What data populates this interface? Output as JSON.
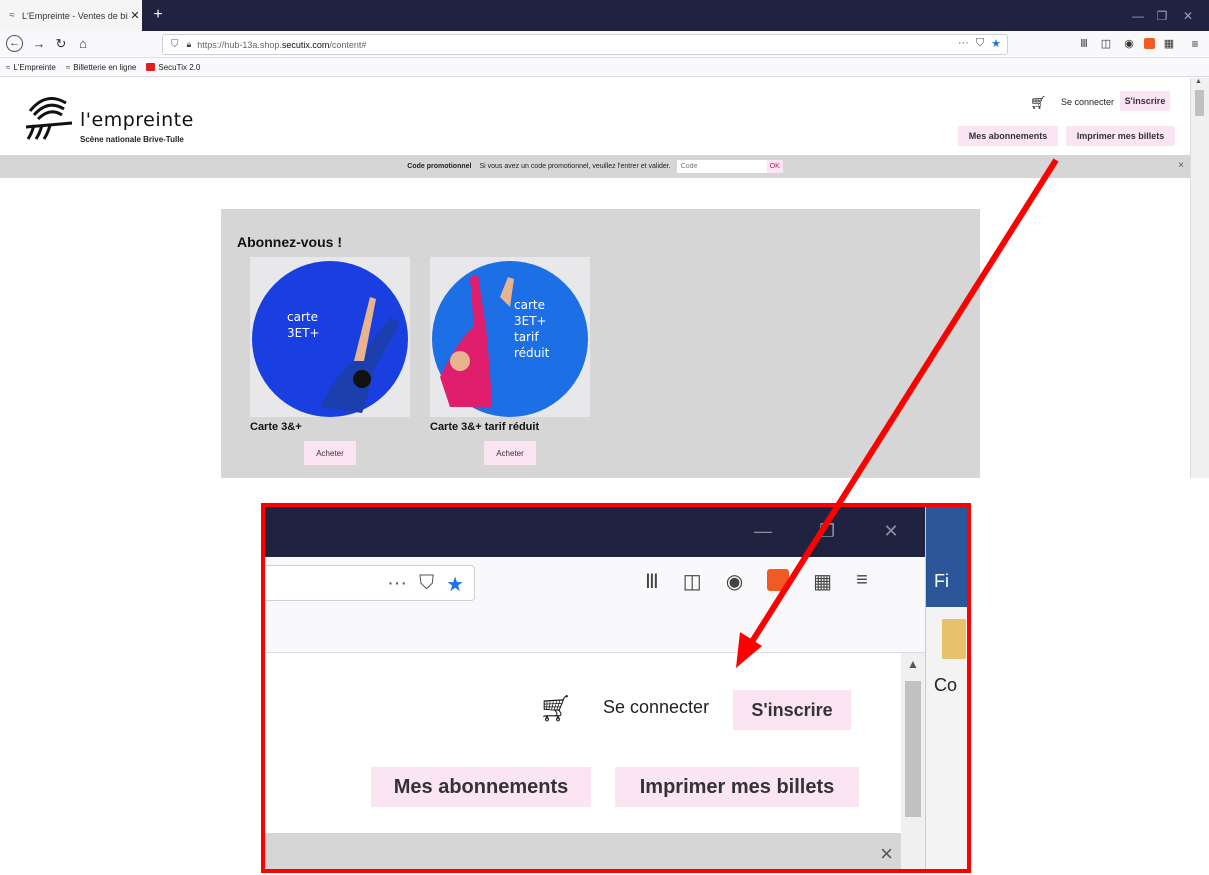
{
  "browser": {
    "tab_title": "L'Empreinte - Ventes de billets",
    "tab_close": "✕",
    "new_tab": "+",
    "url_host": "https://hub-13a.shop.",
    "url_domain": "secutix.com",
    "url_path": "/content#",
    "url_actions": "···",
    "bookmarks": [
      "L'Empreinte",
      "Billetterie en ligne",
      "SecuTix 2.0"
    ]
  },
  "header": {
    "logo_text": "l'empreinte",
    "logo_subtitle": "Scène nationale Brive-Tulle",
    "login": "Se connecter",
    "signup": "S'inscrire",
    "subscriptions": "Mes abonnements",
    "print_tickets": "Imprimer mes billets"
  },
  "promo": {
    "label": "Code promotionnel",
    "text": "Si vous avez un code promotionnel, veuillez l'entrer et valider.",
    "placeholder": "Code",
    "ok": "OK",
    "close": "×"
  },
  "subscriptions_section": {
    "title": "Abonnez-vous !",
    "cards": [
      {
        "name": "Carte 3&+",
        "image_text": [
          "carte",
          "3ET+"
        ],
        "buy": "Acheter",
        "bg": "#1a3fe0",
        "figure": "#1b3fae"
      },
      {
        "name": "Carte 3&+ tarif réduit",
        "image_text": [
          "carte",
          "3ET+",
          "tarif",
          "réduit"
        ],
        "buy": "Acheter",
        "bg": "#1d6fe6",
        "figure": "#e01e6e"
      }
    ]
  },
  "zoom": {
    "login": "Se connecter",
    "signup": "S'inscrire",
    "subscriptions": "Mes abonnements",
    "print_tickets": "Imprimer mes billets",
    "side_tab": "Fi",
    "side_label": "Co"
  },
  "colors": {
    "accent_pink": "#fce5f2",
    "callout_red": "#ff0000",
    "tabbar": "#202340"
  }
}
